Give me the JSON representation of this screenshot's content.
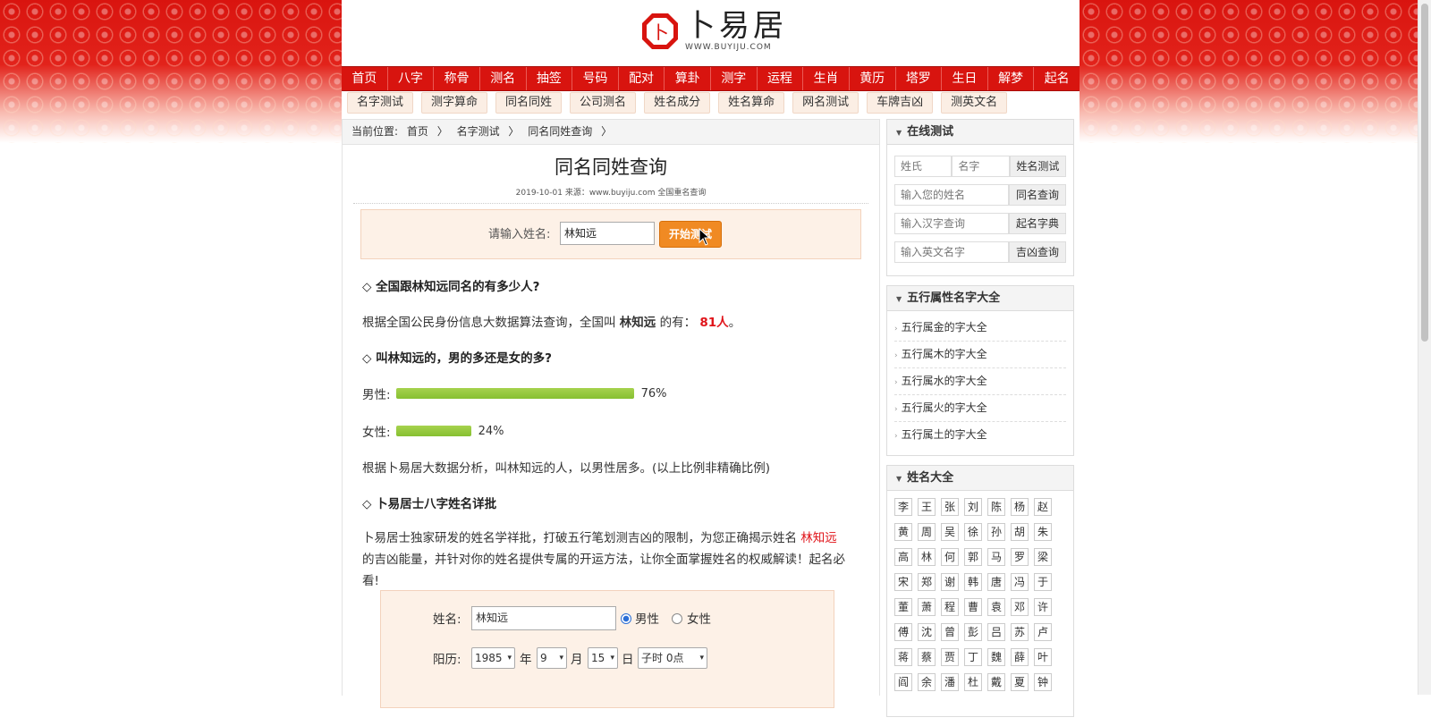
{
  "logo": {
    "cn": "卜易居",
    "mark": "卜",
    "en": "WWW.BUYIJU.COM"
  },
  "main_nav": [
    "首页",
    "八字",
    "称骨",
    "测名",
    "抽签",
    "号码",
    "配对",
    "算卦",
    "测字",
    "运程",
    "生肖",
    "黄历",
    "塔罗",
    "生日",
    "解梦",
    "起名"
  ],
  "sub_nav": [
    "名字测试",
    "测字算命",
    "同名同姓",
    "公司测名",
    "姓名成分",
    "姓名算命",
    "网名测试",
    "车牌吉凶",
    "测英文名"
  ],
  "breadcrumb": {
    "prefix": "当前位置:",
    "items": [
      "首页",
      "〉",
      "名字测试",
      "〉",
      "同名同姓查询",
      "〉"
    ]
  },
  "article": {
    "title": "同名同姓查询",
    "meta": "2019-10-01 来源：www.buyiju.com 全国重名查询"
  },
  "search": {
    "label": "请输入姓名:",
    "value": "林知远",
    "button": "开始测试"
  },
  "sections": {
    "q1": "◇ 全国跟林知远同名的有多少人?",
    "a1_pre": "根据全国公民身份信息大数据算法查询，全国叫",
    "a1_name": "林知远",
    "a1_mid": "的有：",
    "a1_count": "81人",
    "a1_end": "。",
    "q2": "◇ 叫林知远的，男的多还是女的多?",
    "male_label": "男性:",
    "male_pct": "76%",
    "male_value": 0.76,
    "female_label": "女性:",
    "female_pct": "24%",
    "female_value": 0.24,
    "a2": "根据卜易居大数据分析，叫林知远的人，以男性居多。(以上比例非精确比例)",
    "q3": "◇ 卜易居士八字姓名详批",
    "a3_pre": "卜易居士独家研发的姓名学祥批，打破五行笔划测吉凶的限制，为您正确揭示姓名",
    "a3_name": "林知远",
    "a3_post": "的吉凶能量，并针对你的姓名提供专属的开运方法，让你全面掌握姓名的权威解读！起名必看!"
  },
  "form": {
    "name_label": "姓名:",
    "name_value": "林知远",
    "male": "男性",
    "female": "女性",
    "gender_selected": "男性",
    "solar_label": "阳历:",
    "year": "1985",
    "year_unit": "年",
    "month": "9",
    "month_unit": "月",
    "day": "15",
    "day_unit": "日",
    "hour": "子时 0点"
  },
  "sidebar": {
    "online": {
      "title": "在线测试",
      "rows": [
        {
          "a": "姓氏",
          "b": "名字",
          "btn": "姓名测试"
        },
        {
          "a": "输入您的姓名",
          "btn": "同名查询"
        },
        {
          "a": "输入汉字查询",
          "btn": "起名字典"
        },
        {
          "a": "输入英文名字",
          "btn": "吉凶查询"
        }
      ]
    },
    "wuxing": {
      "title": "五行属性名字大全",
      "items": [
        "五行属金的字大全",
        "五行属木的字大全",
        "五行属水的字大全",
        "五行属火的字大全",
        "五行属土的字大全"
      ]
    },
    "surnames": {
      "title": "姓名大全",
      "items": [
        "李",
        "王",
        "张",
        "刘",
        "陈",
        "杨",
        "赵",
        "黄",
        "周",
        "吴",
        "徐",
        "孙",
        "胡",
        "朱",
        "高",
        "林",
        "何",
        "郭",
        "马",
        "罗",
        "梁",
        "宋",
        "郑",
        "谢",
        "韩",
        "唐",
        "冯",
        "于",
        "董",
        "萧",
        "程",
        "曹",
        "袁",
        "邓",
        "许",
        "傅",
        "沈",
        "曾",
        "彭",
        "吕",
        "苏",
        "卢",
        "蒋",
        "蔡",
        "贾",
        "丁",
        "魏",
        "薛",
        "叶",
        "阎",
        "余",
        "潘",
        "杜",
        "戴",
        "夏",
        "钟"
      ]
    }
  },
  "colors": {
    "nav_red": "#d8140f",
    "highlight_red": "#e0141a",
    "bar_green": "#8dc63f",
    "button_orange": "#f08a23"
  }
}
